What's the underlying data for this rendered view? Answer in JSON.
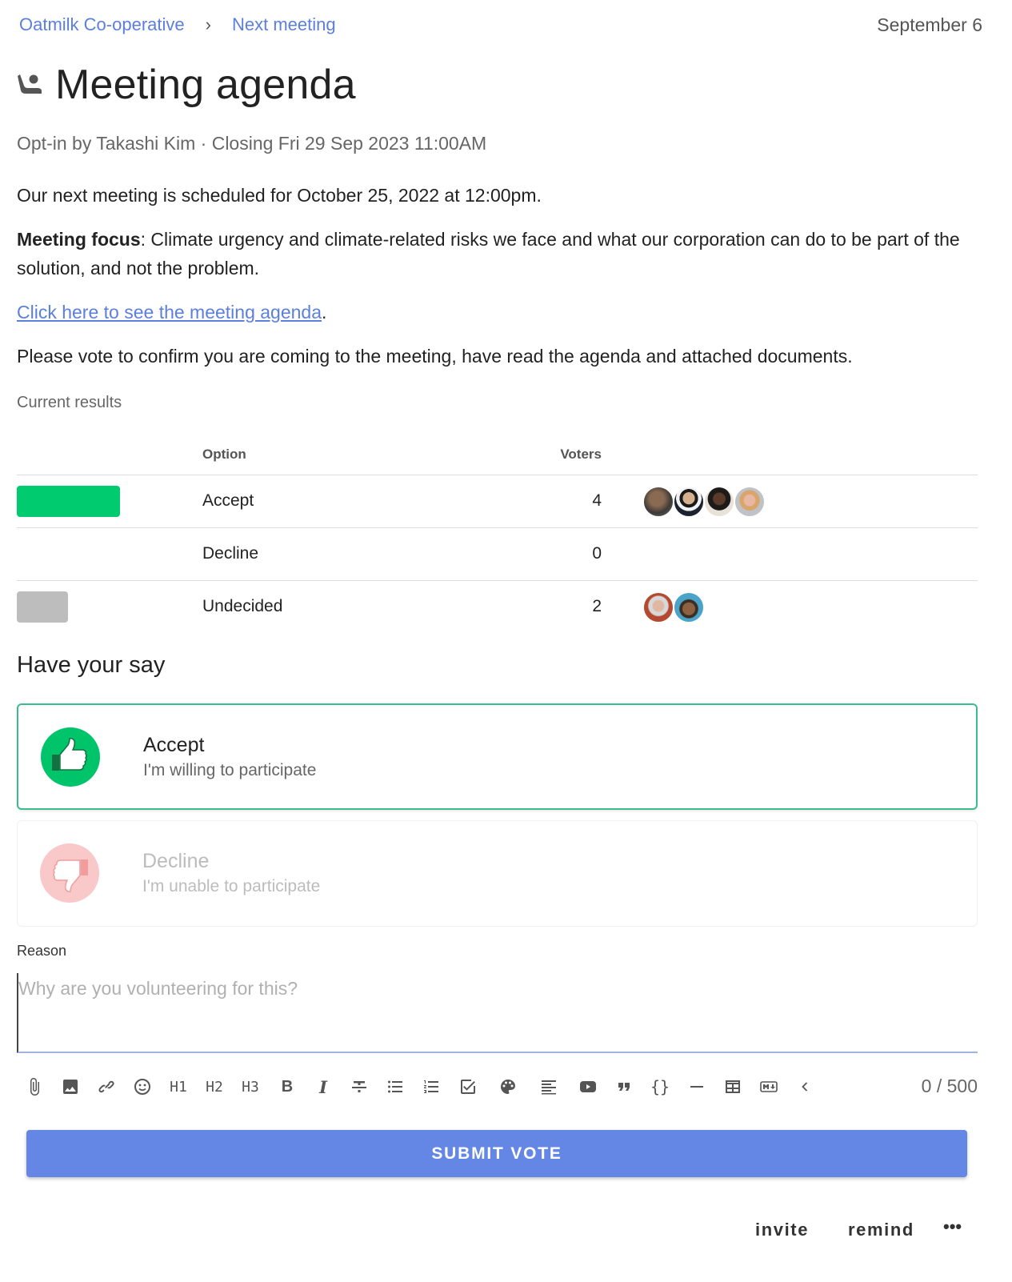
{
  "breadcrumb": {
    "group": "Oatmilk Co-operative",
    "separator": "›",
    "thread": "Next meeting"
  },
  "date": "September 6",
  "title": "Meeting agenda",
  "meta": "Opt-in by Takashi Kim · Closing Fri 29 Sep 2023 11:00AM",
  "description": {
    "line1": "Our next meeting is scheduled for October 25, 2022 at 12:00pm.",
    "focus_label": "Meeting focus",
    "focus_text": ": Climate urgency and climate-related risks we face and what our corporation can do to be part of the solution, and not the problem.",
    "link_text": "Click here to see the meeting agenda",
    "link_suffix": ".",
    "line4": "Please vote to confirm you are coming to the meeting, have read the agenda and attached documents."
  },
  "results": {
    "label": "Current results",
    "col_option": "Option",
    "col_voters": "Voters",
    "rows": [
      {
        "option": "Accept",
        "count": "4",
        "share": 0.667,
        "color": "#00cc6f",
        "avatars": 4
      },
      {
        "option": "Decline",
        "count": "0",
        "share": 0,
        "color": "#f5c3c3",
        "avatars": 0
      },
      {
        "option": "Undecided",
        "count": "2",
        "share": 0.333,
        "color": "#bdbdbd",
        "avatars": 2
      }
    ]
  },
  "have_your_say": "Have your say",
  "choices": {
    "accept": {
      "label": "Accept",
      "sub": "I'm willing to participate",
      "color": "#00c46a"
    },
    "decline": {
      "label": "Decline",
      "sub": "I'm unable to participate",
      "color": "#f9c8c8"
    }
  },
  "reason": {
    "label": "Reason",
    "placeholder": "Why are you volunteering for this?"
  },
  "toolbar": {
    "h1": "H1",
    "h2": "H2",
    "h3": "H3",
    "bold": "B",
    "italic": "I",
    "code": "{}",
    "counter": "0 / 500"
  },
  "submit_label": "SUBMIT VOTE",
  "footer": {
    "invite": "invite",
    "remind": "remind",
    "more": "•••"
  }
}
